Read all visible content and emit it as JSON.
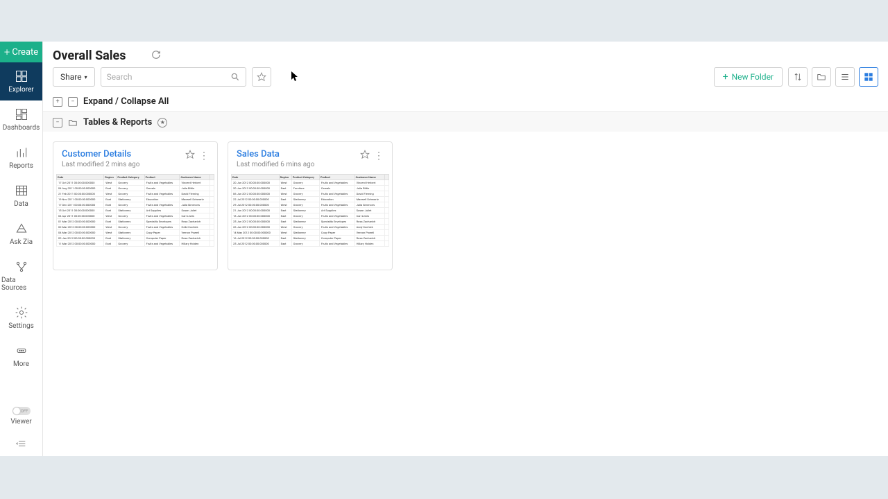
{
  "sidebar": {
    "create_label": "Create",
    "items": [
      {
        "label": "Explorer"
      },
      {
        "label": "Dashboards"
      },
      {
        "label": "Reports"
      },
      {
        "label": "Data"
      },
      {
        "label": "Ask Zia"
      },
      {
        "label": "Data Sources"
      },
      {
        "label": "Settings"
      },
      {
        "label": "More"
      }
    ],
    "viewer_label": "Viewer",
    "viewer_off": "OFF"
  },
  "header": {
    "title": "Overall Sales"
  },
  "toolbar": {
    "share_label": "Share",
    "search_placeholder": "Search",
    "new_folder_label": "New Folder"
  },
  "expand": {
    "label": "Expand / Collapse All"
  },
  "folder": {
    "name": "Tables & Reports"
  },
  "cards": [
    {
      "title": "Customer Details",
      "subtitle": "Last modified 2 mins ago",
      "columns": [
        "Date",
        "Region",
        "Product Category",
        "Product",
        "Customer Name"
      ],
      "rows": [
        [
          "17 Oct 2011 00:00:00:000000",
          "West",
          "Grocery",
          "Fruits and Vegetables",
          "Vincent Herbert"
        ],
        [
          "04 Aug 2011 00:00:00:000000",
          "East",
          "Grocery",
          "Cereals",
          "Julia Bittie"
        ],
        [
          "21 Feb 2011 00:00:00:000000",
          "West",
          "Grocery",
          "Fruits and Vegetables",
          "David Fleming"
        ],
        [
          "19 Nov 2011 00:00:00:000000",
          "East",
          "Stationery",
          "Education",
          "Maxwell Schwartz"
        ],
        [
          "17 Dec 2011 00:00:00:000000",
          "East",
          "Grocery",
          "Fruits and Vegetables",
          "Julia Simmons"
        ],
        [
          "15 Oct 2011 00:00:00:000000",
          "East",
          "Stationery",
          "Art Supplies",
          "Susan Juliet"
        ],
        [
          "04 Apr 2011 00:00:00:000000",
          "West",
          "Grocery",
          "Fruits and Vegetables",
          "Carl Lewis"
        ],
        [
          "01 Mar 2012 00:00:00:000000",
          "East",
          "Stationery",
          "Speciality Envelopes",
          "Rosa Zacharich"
        ],
        [
          "02 Mar 2012 00:00:00:000000",
          "West",
          "Grocery",
          "Fruits and Vegetables",
          "Heiki Kochick"
        ],
        [
          "04 Mar 2012 00:00:00:000000",
          "West",
          "Stationery",
          "Copy Paper",
          "Vernon Powell"
        ],
        [
          "09 Jan 2012 00:00:00:000000",
          "East",
          "Stationery",
          "Computer Paper",
          "Rosa Zacharich"
        ],
        [
          "11 Mar 2012 00:00:00:000000",
          "East",
          "Grocery",
          "Fruits and Vegetables",
          "Hillary Holden"
        ]
      ]
    },
    {
      "title": "Sales Data",
      "subtitle": "Last modified 6 mins ago",
      "columns": [
        "Date",
        "Region",
        "Product Category",
        "Product",
        "Customer Name"
      ],
      "rows": [
        [
          "20 Jun 2012 00:00:00:000000",
          "West",
          "Grocery",
          "Fruits and Vegetables",
          "Vincent Herbert"
        ],
        [
          "20 Jun 2012 00:00:00:000000",
          "East",
          "Furniture",
          "Cereals",
          "Julia Bittie"
        ],
        [
          "06 Jun 2012 00:00:00:000000",
          "West",
          "Grocery",
          "Fruits and Vegetables",
          "David Fleming"
        ],
        [
          "22 Jul 2012 00:00:00:000000",
          "East",
          "Stationery",
          "Education",
          "Maxwell Schwartz"
        ],
        [
          "29 Jul 2012 00:00:00:000000",
          "West",
          "Grocery",
          "Fruits and Vegetables",
          "Julia Simmons"
        ],
        [
          "21 Jun 2012 00:00:00:000000",
          "East",
          "Stationery",
          "Art Supplies",
          "Susan Juliet"
        ],
        [
          "18 Jun 2012 00:00:00:000000",
          "East",
          "Grocery",
          "Fruits and Vegetables",
          "Carl Lewis"
        ],
        [
          "25 Jun 2012 00:00:00:000000",
          "East",
          "Stationery",
          "Speciality Envelopes",
          "Rosa Zacharich"
        ],
        [
          "26 Jun 2012 00:00:00:000000",
          "West",
          "Grocery",
          "Fruits and Vegetables",
          "Andy Kochick"
        ],
        [
          "14 May 2012 00:00:00:000000",
          "West",
          "Stationery",
          "Copy Paper",
          "Vernon Powell"
        ],
        [
          "16 Jul 2012 00:00:00:000000",
          "East",
          "Stationery",
          "Computer Paper",
          "Rosa Zacharich"
        ],
        [
          "25 Jul 2012 00:00:00:000000",
          "East",
          "Grocery",
          "Fruits and Vegetables",
          "Hillary Holden"
        ]
      ]
    }
  ]
}
